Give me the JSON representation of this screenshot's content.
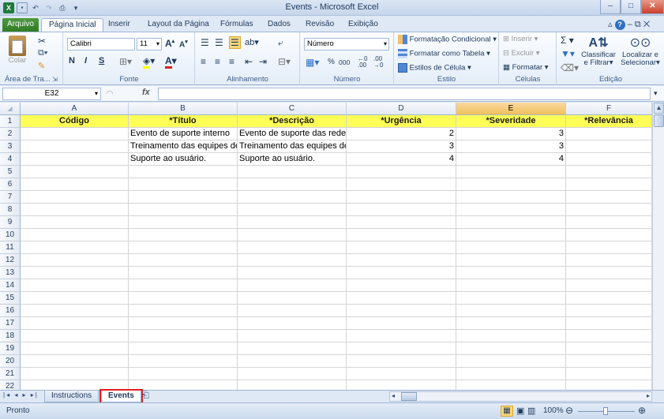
{
  "window": {
    "title": "Events  -  Microsoft Excel",
    "controls": {
      "minimize": "–",
      "restore": "□",
      "close": "✕"
    }
  },
  "ribbon_tabs": [
    {
      "label": "Arquivo"
    },
    {
      "label": "Página Inicial"
    },
    {
      "label": "Inserir"
    },
    {
      "label": "Layout da Página"
    },
    {
      "label": "Fórmulas"
    },
    {
      "label": "Dados"
    },
    {
      "label": "Revisão"
    },
    {
      "label": "Exibição"
    }
  ],
  "ribbon": {
    "clipboard": {
      "group": "Área de Tra...",
      "paste": "Colar"
    },
    "font": {
      "group": "Fonte",
      "name": "Calibri",
      "size": "11",
      "bold": "N",
      "italic": "I",
      "underline": "S"
    },
    "alignment": {
      "group": "Alinhamento"
    },
    "number": {
      "group": "Número",
      "format": "Número",
      "percent": "%",
      "thousands": "000"
    },
    "styles": {
      "group": "Estilo",
      "conditional": "Formatação Condicional",
      "as_table": "Formatar como Tabela",
      "cell_styles": "Estilos de Célula"
    },
    "cells": {
      "group": "Células",
      "insert": "Inserir",
      "delete": "Excluir",
      "format": "Formatar"
    },
    "editing": {
      "group": "Edição",
      "sort": "Classificar",
      "filter": "e Filtrar",
      "find": "Localizar e",
      "select": "Selecionar"
    }
  },
  "formula_bar": {
    "name_box": "E32",
    "fx": "fx",
    "value": ""
  },
  "columns": [
    "A",
    "B",
    "C",
    "D",
    "E",
    "F"
  ],
  "selected_column": "E",
  "rows": [
    "1",
    "2",
    "3",
    "4",
    "5",
    "6",
    "7",
    "8",
    "9",
    "10",
    "11",
    "12",
    "13",
    "14",
    "15",
    "16",
    "17",
    "18",
    "19",
    "20",
    "21",
    "22"
  ],
  "cells": {
    "A1": "Código",
    "B1": "*Título",
    "C1": "*Descrição",
    "D1": "*Urgência",
    "E1": "*Severidade",
    "F1": "*Relevância",
    "B2": "Evento de suporte interno",
    "C2": "Evento de suporte das redes",
    "D2": "2",
    "E2": "3",
    "B3": "Treinamento das equipes de",
    "C3": "Treinamento das equipes de",
    "D3": "3",
    "E3": "3",
    "B4": "Suporte ao usuário.",
    "C4": "Suporte ao usuário.",
    "D4": "4",
    "E4": "4"
  },
  "sheet_tabs": [
    {
      "label": "Instructions"
    },
    {
      "label": "Events"
    }
  ],
  "active_sheet": "Events",
  "status": {
    "ready": "Pronto",
    "zoom": "100%"
  }
}
